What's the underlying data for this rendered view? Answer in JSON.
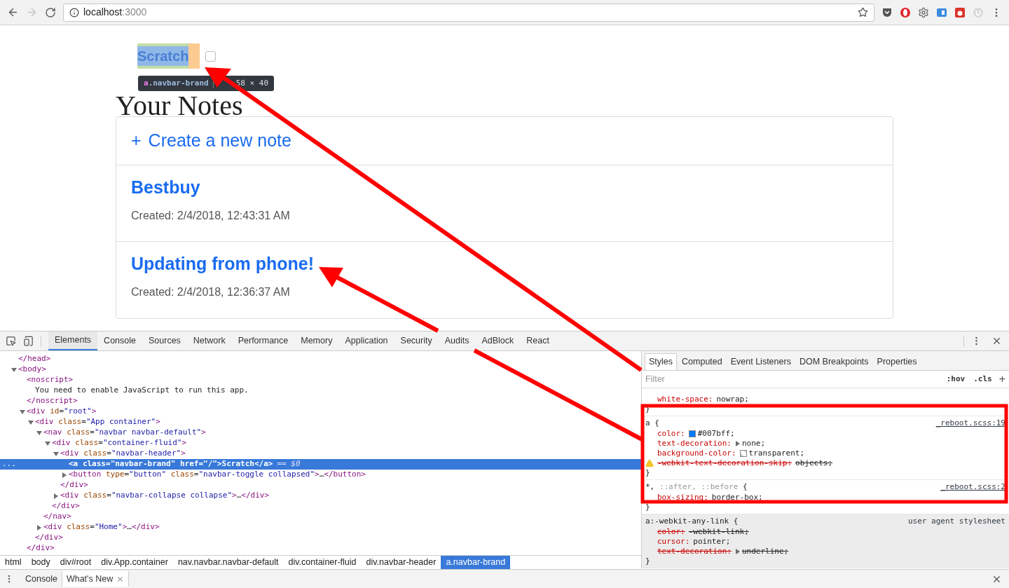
{
  "browser": {
    "url_host": "localhost",
    "url_port": ":3000"
  },
  "page": {
    "brand": "Scratch",
    "inspect_tooltip": {
      "tag": "a",
      "class_name": ".navbar-brand",
      "size": "58 × 40"
    },
    "heading": "Your Notes",
    "create_icon": "+",
    "create_label": "Create a new note",
    "notes": [
      {
        "title": "Bestbuy",
        "created": "Created: 2/4/2018, 12:43:31 AM"
      },
      {
        "title": "Updating from phone!",
        "created": "Created: 2/4/2018, 12:36:37 AM"
      }
    ]
  },
  "devtools": {
    "tabs": [
      {
        "label": "Elements",
        "selected": true
      },
      {
        "label": "Console",
        "selected": false
      },
      {
        "label": "Sources",
        "selected": false
      },
      {
        "label": "Network",
        "selected": false
      },
      {
        "label": "Performance",
        "selected": false
      },
      {
        "label": "Memory",
        "selected": false
      },
      {
        "label": "Application",
        "selected": false
      },
      {
        "label": "Security",
        "selected": false
      },
      {
        "label": "Audits",
        "selected": false
      },
      {
        "label": "AdBlock",
        "selected": false
      },
      {
        "label": "React",
        "selected": false
      }
    ],
    "dom": [
      {
        "kind": "end_tag",
        "close": "</head>"
      },
      {
        "kind": "element",
        "open": "<body>",
        "expanded": true,
        "selected": false,
        "children": [
          {
            "kind": "element",
            "open": "<noscript>",
            "close": "</noscript>",
            "selected": false,
            "children": [
              {
                "kind": "text",
                "text": "You need to enable JavaScript to run this app."
              }
            ]
          },
          {
            "kind": "element",
            "open": "<div id=\"root\">",
            "close": "</div>",
            "expanded": true,
            "selected": false,
            "children": [
              {
                "kind": "element",
                "open": "<div class=\"App container\">",
                "close": "</div>",
                "expanded": true,
                "selected": false,
                "children": [
                  {
                    "kind": "element",
                    "open": "<nav class=\"navbar navbar-default\">",
                    "close": "</nav>",
                    "expanded": true,
                    "selected": false,
                    "children": [
                      {
                        "kind": "element",
                        "open": "<div class=\"container-fluid\">",
                        "close": "</div>",
                        "expanded": true,
                        "selected": false,
                        "children": [
                          {
                            "kind": "element",
                            "open": "<div class=\"navbar-header\">",
                            "close": "</div>",
                            "expanded": true,
                            "selected": false,
                            "children": [
                              {
                                "kind": "element",
                                "open": "<a class=\"navbar-brand\" href=\"/\">",
                                "inline_text": "Scratch",
                                "close": "</a>",
                                "marker": "== $0",
                                "row_menu": "...",
                                "selected": true
                              },
                              {
                                "kind": "element",
                                "open": "<button type=\"button\" class=\"navbar-toggle collapsed\">",
                                "ellipsis": "…",
                                "close": "</button>",
                                "expanded": false,
                                "selected": false
                              }
                            ]
                          },
                          {
                            "kind": "element",
                            "open": "<div class=\"navbar-collapse collapse\">",
                            "ellipsis": "…",
                            "close": "</div>",
                            "expanded": false,
                            "selected": false
                          }
                        ]
                      }
                    ]
                  },
                  {
                    "kind": "element",
                    "open": "<div class=\"Home\">",
                    "ellipsis": "…",
                    "close": "</div>",
                    "expanded": false,
                    "selected": false
                  }
                ]
              }
            ]
          }
        ]
      }
    ],
    "breadcrumbs": [
      {
        "label": "html",
        "selected": false
      },
      {
        "label": "body",
        "selected": false
      },
      {
        "label": "div#root",
        "selected": false
      },
      {
        "label": "div.App.container",
        "selected": false
      },
      {
        "label": "nav.navbar.navbar-default",
        "selected": false
      },
      {
        "label": "div.container-fluid",
        "selected": false
      },
      {
        "label": "div.navbar-header",
        "selected": false
      },
      {
        "label": "a.navbar-brand",
        "selected": true
      }
    ],
    "styles_tabs": [
      {
        "label": "Styles",
        "selected": true
      },
      {
        "label": "Computed",
        "selected": false
      },
      {
        "label": "Event Listeners",
        "selected": false
      },
      {
        "label": "DOM Breakpoints",
        "selected": false
      },
      {
        "label": "Properties",
        "selected": false
      }
    ],
    "filter_placeholder": "Filter",
    "hov": ":hov",
    "cls": ".cls",
    "add": "+",
    "rules": [
      {
        "user_agent": false,
        "close": "}",
        "properties": [
          {
            "name": "white-space:",
            "value": "nowrap;",
            "overridden": false
          }
        ]
      },
      {
        "user_agent": false,
        "selector": [
          {
            "text": "a {",
            "matched": true
          }
        ],
        "source": "_reboot.scss:19",
        "close": "}",
        "properties": [
          {
            "name": "color:",
            "value": "#007bff;",
            "overridden": false,
            "swatch": {
              "kind": "color",
              "color": "#007bff"
            }
          },
          {
            "name": "text-decoration:",
            "value": "none;",
            "overridden": false,
            "expandable": true
          },
          {
            "name": "background-color:",
            "value": "transparent;",
            "overridden": false,
            "swatch": {
              "kind": "checker"
            }
          },
          {
            "name": "-webkit-text-decoration-skip:",
            "value": "objects;",
            "overridden": true,
            "warning": true
          }
        ]
      },
      {
        "user_agent": false,
        "selector": [
          {
            "text": "*,",
            "matched": true
          },
          {
            "text": "::after, ::before",
            "matched": false
          },
          {
            "text": "{",
            "matched": true
          }
        ],
        "source": "_reboot.scss:2",
        "close": "}",
        "properties": [
          {
            "name": "box-sizing:",
            "value": "border-box;",
            "overridden": false
          }
        ]
      },
      {
        "user_agent": true,
        "selector": [
          {
            "text": "a:-webkit-any-link {",
            "matched": true
          }
        ],
        "source": "user agent stylesheet",
        "close": "}",
        "properties": [
          {
            "name": "color:",
            "value": "-webkit-link;",
            "overridden": true
          },
          {
            "name": "cursor:",
            "value": "pointer;",
            "overridden": false
          },
          {
            "name": "text-decoration:",
            "value": "underline;",
            "overridden": true,
            "expandable": true
          }
        ]
      }
    ]
  },
  "drawer": {
    "tabs": [
      {
        "label": "Console",
        "selected": false,
        "closable": false
      },
      {
        "label": "What's New",
        "selected": true,
        "closable": true
      }
    ]
  }
}
